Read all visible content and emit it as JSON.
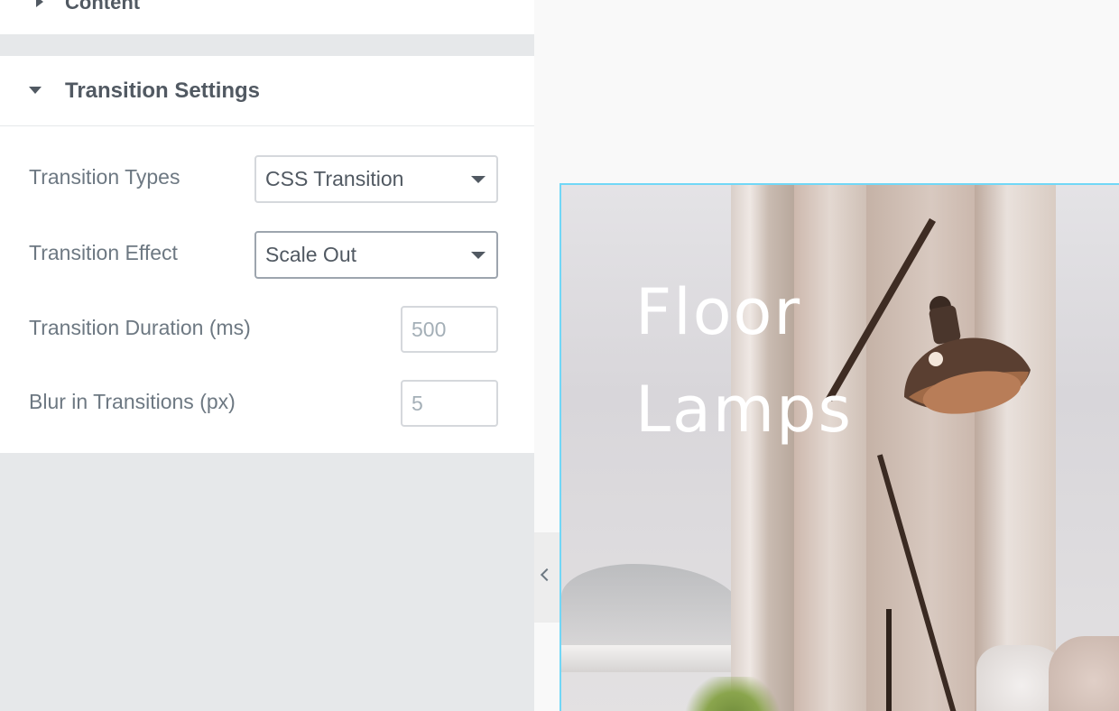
{
  "panel": {
    "collapsed_section_title": "Content",
    "section_title": "Transition Settings",
    "controls": {
      "transition_types": {
        "label": "Transition Types",
        "value": "CSS Transition"
      },
      "transition_effect": {
        "label": "Transition Effect",
        "value": "Scale Out"
      },
      "transition_duration": {
        "label": "Transition Duration (ms)",
        "placeholder": "500"
      },
      "blur": {
        "label": "Blur in Transitions (px)",
        "placeholder": "5"
      }
    }
  },
  "preview": {
    "heading_line1": "Floor",
    "heading_line2": "Lamps"
  },
  "colors": {
    "panel_bg": "#e6e8ea",
    "text": "#515962",
    "selection_border": "#71d7f7"
  },
  "icons": {
    "collapsed_caret": "caret-right-icon",
    "expanded_caret": "caret-down-icon",
    "select_arrow": "caret-down-icon",
    "collapse_panel": "chevron-left-icon"
  }
}
